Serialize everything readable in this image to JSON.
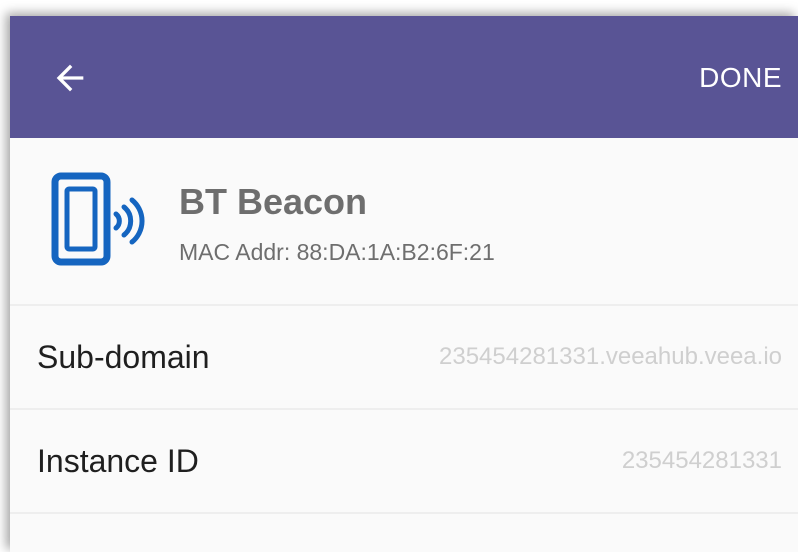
{
  "header": {
    "back_icon": "arrow-back-icon",
    "done_label": "DONE",
    "background_color": "#595495"
  },
  "device": {
    "icon": "phone-broadcast-icon",
    "icon_color": "#1565c0",
    "name": "BT Beacon",
    "mac": "MAC Addr: 88:DA:1A:B2:6F:21"
  },
  "rows": [
    {
      "label": "Sub-domain",
      "value": "235454281331.veeahub.veea.io"
    },
    {
      "label": "Instance ID",
      "value": "235454281331"
    }
  ]
}
